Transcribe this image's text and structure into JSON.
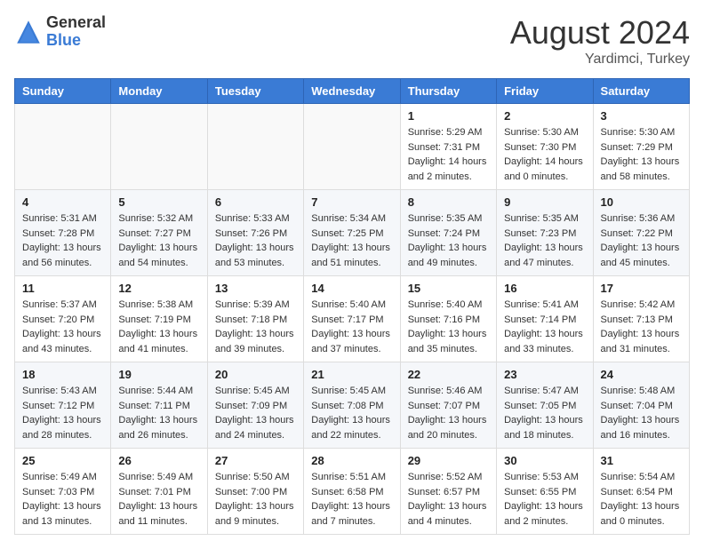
{
  "header": {
    "logo_general": "General",
    "logo_blue": "Blue",
    "main_title": "August 2024",
    "subtitle": "Yardimci, Turkey"
  },
  "calendar": {
    "headers": [
      "Sunday",
      "Monday",
      "Tuesday",
      "Wednesday",
      "Thursday",
      "Friday",
      "Saturday"
    ],
    "weeks": [
      [
        {
          "day": "",
          "info": ""
        },
        {
          "day": "",
          "info": ""
        },
        {
          "day": "",
          "info": ""
        },
        {
          "day": "",
          "info": ""
        },
        {
          "day": "1",
          "info": "Sunrise: 5:29 AM\nSunset: 7:31 PM\nDaylight: 14 hours\nand 2 minutes."
        },
        {
          "day": "2",
          "info": "Sunrise: 5:30 AM\nSunset: 7:30 PM\nDaylight: 14 hours\nand 0 minutes."
        },
        {
          "day": "3",
          "info": "Sunrise: 5:30 AM\nSunset: 7:29 PM\nDaylight: 13 hours\nand 58 minutes."
        }
      ],
      [
        {
          "day": "4",
          "info": "Sunrise: 5:31 AM\nSunset: 7:28 PM\nDaylight: 13 hours\nand 56 minutes."
        },
        {
          "day": "5",
          "info": "Sunrise: 5:32 AM\nSunset: 7:27 PM\nDaylight: 13 hours\nand 54 minutes."
        },
        {
          "day": "6",
          "info": "Sunrise: 5:33 AM\nSunset: 7:26 PM\nDaylight: 13 hours\nand 53 minutes."
        },
        {
          "day": "7",
          "info": "Sunrise: 5:34 AM\nSunset: 7:25 PM\nDaylight: 13 hours\nand 51 minutes."
        },
        {
          "day": "8",
          "info": "Sunrise: 5:35 AM\nSunset: 7:24 PM\nDaylight: 13 hours\nand 49 minutes."
        },
        {
          "day": "9",
          "info": "Sunrise: 5:35 AM\nSunset: 7:23 PM\nDaylight: 13 hours\nand 47 minutes."
        },
        {
          "day": "10",
          "info": "Sunrise: 5:36 AM\nSunset: 7:22 PM\nDaylight: 13 hours\nand 45 minutes."
        }
      ],
      [
        {
          "day": "11",
          "info": "Sunrise: 5:37 AM\nSunset: 7:20 PM\nDaylight: 13 hours\nand 43 minutes."
        },
        {
          "day": "12",
          "info": "Sunrise: 5:38 AM\nSunset: 7:19 PM\nDaylight: 13 hours\nand 41 minutes."
        },
        {
          "day": "13",
          "info": "Sunrise: 5:39 AM\nSunset: 7:18 PM\nDaylight: 13 hours\nand 39 minutes."
        },
        {
          "day": "14",
          "info": "Sunrise: 5:40 AM\nSunset: 7:17 PM\nDaylight: 13 hours\nand 37 minutes."
        },
        {
          "day": "15",
          "info": "Sunrise: 5:40 AM\nSunset: 7:16 PM\nDaylight: 13 hours\nand 35 minutes."
        },
        {
          "day": "16",
          "info": "Sunrise: 5:41 AM\nSunset: 7:14 PM\nDaylight: 13 hours\nand 33 minutes."
        },
        {
          "day": "17",
          "info": "Sunrise: 5:42 AM\nSunset: 7:13 PM\nDaylight: 13 hours\nand 31 minutes."
        }
      ],
      [
        {
          "day": "18",
          "info": "Sunrise: 5:43 AM\nSunset: 7:12 PM\nDaylight: 13 hours\nand 28 minutes."
        },
        {
          "day": "19",
          "info": "Sunrise: 5:44 AM\nSunset: 7:11 PM\nDaylight: 13 hours\nand 26 minutes."
        },
        {
          "day": "20",
          "info": "Sunrise: 5:45 AM\nSunset: 7:09 PM\nDaylight: 13 hours\nand 24 minutes."
        },
        {
          "day": "21",
          "info": "Sunrise: 5:45 AM\nSunset: 7:08 PM\nDaylight: 13 hours\nand 22 minutes."
        },
        {
          "day": "22",
          "info": "Sunrise: 5:46 AM\nSunset: 7:07 PM\nDaylight: 13 hours\nand 20 minutes."
        },
        {
          "day": "23",
          "info": "Sunrise: 5:47 AM\nSunset: 7:05 PM\nDaylight: 13 hours\nand 18 minutes."
        },
        {
          "day": "24",
          "info": "Sunrise: 5:48 AM\nSunset: 7:04 PM\nDaylight: 13 hours\nand 16 minutes."
        }
      ],
      [
        {
          "day": "25",
          "info": "Sunrise: 5:49 AM\nSunset: 7:03 PM\nDaylight: 13 hours\nand 13 minutes."
        },
        {
          "day": "26",
          "info": "Sunrise: 5:49 AM\nSunset: 7:01 PM\nDaylight: 13 hours\nand 11 minutes."
        },
        {
          "day": "27",
          "info": "Sunrise: 5:50 AM\nSunset: 7:00 PM\nDaylight: 13 hours\nand 9 minutes."
        },
        {
          "day": "28",
          "info": "Sunrise: 5:51 AM\nSunset: 6:58 PM\nDaylight: 13 hours\nand 7 minutes."
        },
        {
          "day": "29",
          "info": "Sunrise: 5:52 AM\nSunset: 6:57 PM\nDaylight: 13 hours\nand 4 minutes."
        },
        {
          "day": "30",
          "info": "Sunrise: 5:53 AM\nSunset: 6:55 PM\nDaylight: 13 hours\nand 2 minutes."
        },
        {
          "day": "31",
          "info": "Sunrise: 5:54 AM\nSunset: 6:54 PM\nDaylight: 13 hours\nand 0 minutes."
        }
      ]
    ]
  }
}
